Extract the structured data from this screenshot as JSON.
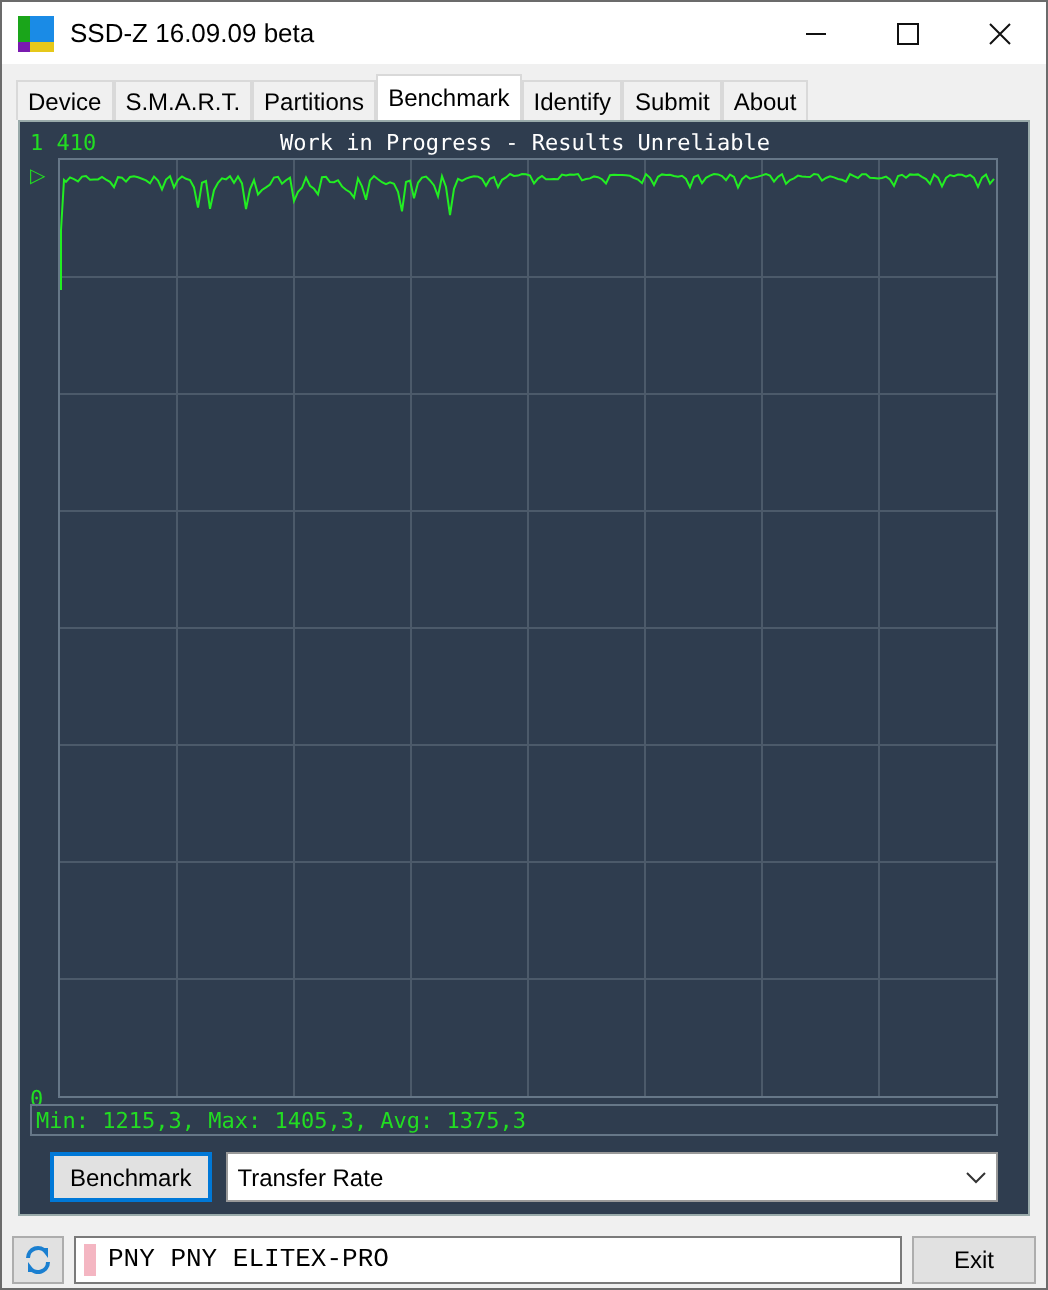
{
  "window": {
    "title": "SSD-Z 16.09.09 beta"
  },
  "tabs": [
    {
      "label": "Device",
      "selected": false
    },
    {
      "label": "S.M.A.R.T.",
      "selected": false
    },
    {
      "label": "Partitions",
      "selected": false
    },
    {
      "label": "Benchmark",
      "selected": true
    },
    {
      "label": "Identify",
      "selected": false
    },
    {
      "label": "Submit",
      "selected": false
    },
    {
      "label": "About",
      "selected": false
    }
  ],
  "graph": {
    "title": "Work in Progress - Results Unreliable",
    "y_max_label": "1 410",
    "y_min_label": "0",
    "marker": "▷",
    "stats": "Min: 1215,3, Max: 1405,3, Avg: 1375,3"
  },
  "benchmark_button": "Benchmark",
  "mode_dropdown": {
    "value": "Transfer Rate"
  },
  "drive_field": {
    "value": "PNY PNY ELITEX-PRO"
  },
  "exit_button": "Exit"
}
